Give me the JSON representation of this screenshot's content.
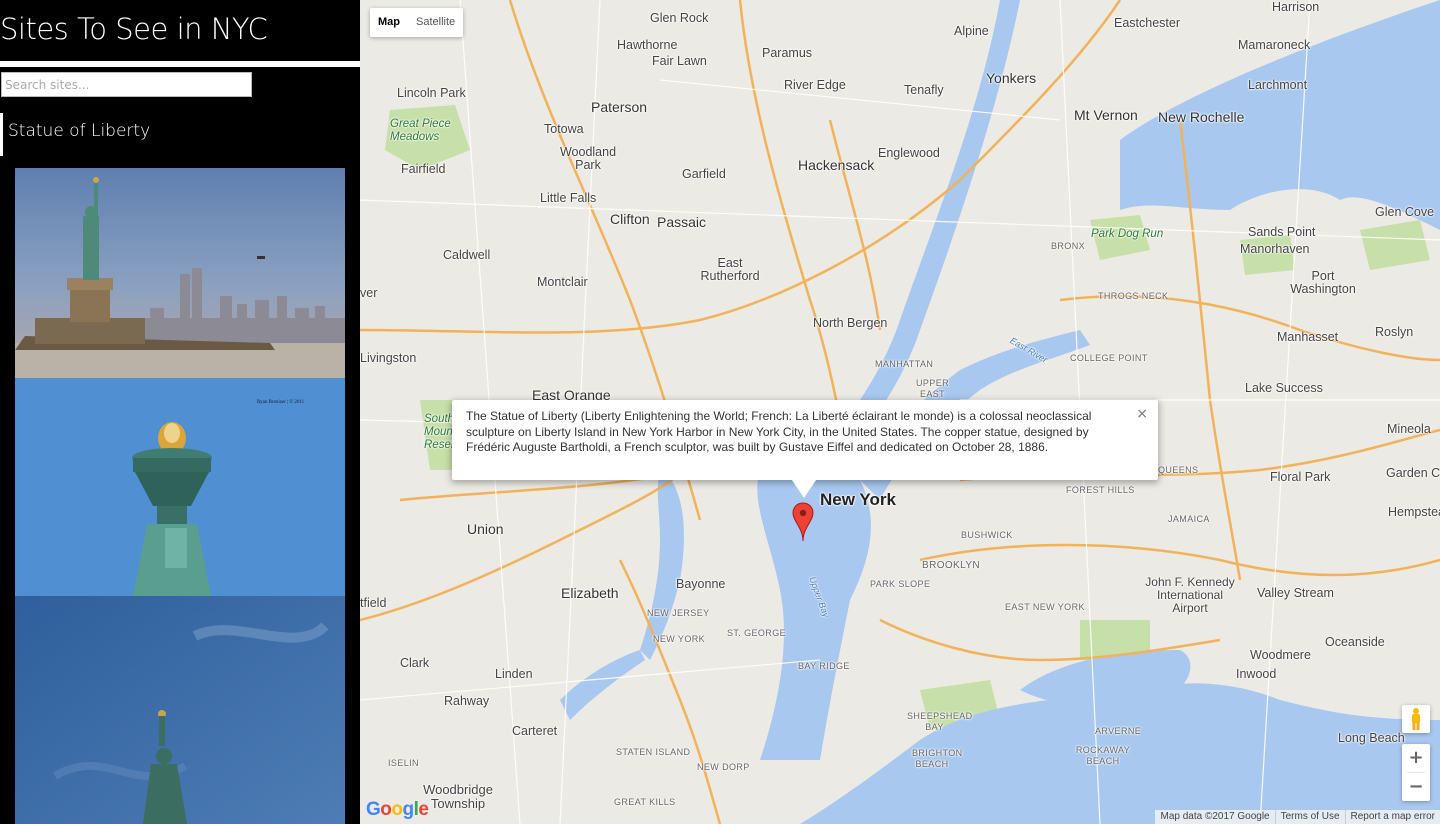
{
  "sidebar": {
    "title": "Sites To See in NYC",
    "search_placeholder": "Search sites...",
    "items": [
      {
        "label": "Statue of Liberty"
      }
    ],
    "photos": [
      {
        "credit": "Ryan Brenizer | © 2011"
      }
    ]
  },
  "map": {
    "type_control": {
      "map_label": "Map",
      "satellite_label": "Satellite",
      "selected": "Map"
    },
    "infowindow": {
      "text": "The Statue of Liberty (Liberty Enlightening the World; French: La Liberté éclairant le monde) is a colossal neoclassical sculpture on Liberty Island in New York Harbor in New York City, in the United States. The copper statue, designed by Frédéric Auguste Bartholdi, a French sculptor, was built by Gustave Eiffel and dedicated on October 28, 1886.",
      "close_symbol": "×"
    },
    "labels": {
      "glen_rock": "Glen Rock",
      "hawthorne": "Hawthorne",
      "paramus": "Paramus",
      "fair_lawn": "Fair Lawn",
      "river_edge": "River Edge",
      "alpine": "Alpine",
      "eastchester": "Eastchester",
      "harrison": "Harrison",
      "mamaroneck": "Mamaroneck",
      "larchmont": "Larchmont",
      "yonkers": "Yonkers",
      "lincoln_park": "Lincoln Park",
      "paterson": "Paterson",
      "tenafly": "Tenafly",
      "totowa": "Totowa",
      "great_piece_meadows": "Great Piece Meadows",
      "woodland_park": "Woodland Park",
      "hackensack": "Hackensack",
      "englewood": "Englewood",
      "mt_vernon": "Mt Vernon",
      "new_rochelle": "New Rochelle",
      "fairfield": "Fairfield",
      "garfield": "Garfield",
      "little_falls": "Little Falls",
      "clifton": "Clifton",
      "passaic": "Passaic",
      "glen_cove": "Glen Cove",
      "sands_point": "Sands Point",
      "manorhaven": "Manorhaven",
      "park_dog_run": "Park Dog Run",
      "bronx": "BRONX",
      "caldwell": "Caldwell",
      "east_rutherford": "East Rutherford",
      "port_washington": "Port Washington",
      "montclair": "Montclair",
      "throgs_neck": "THROGS NECK",
      "north_bergen": "North Bergen",
      "manhasset": "Manhasset",
      "roslyn": "Roslyn",
      "livingston": "Livingston",
      "manhattan": "MANHATTAN",
      "upper_east_side": "UPPER EAST SIDE",
      "college_point": "COLLEGE POINT",
      "east_river": "East River",
      "east_orange": "East Orange",
      "lake_success": "Lake Success",
      "mineola": "Mineola",
      "queens": "QUEENS",
      "new_york": "New York",
      "forest_hills": "FOREST HILLS",
      "floral_park": "Floral Park",
      "garden_city": "Garden City",
      "jamaica": "JAMAICA",
      "hempstead": "Hempstead",
      "union": "Union",
      "bushwick": "BUSHWICK",
      "brooklyn": "BROOKLYN",
      "elizabeth": "Elizabeth",
      "bayonne": "Bayonne",
      "valley_stream": "Valley Stream",
      "park_slope": "PARK SLOPE",
      "jfk": "John F. Kennedy International Airport",
      "new_jersey": "NEW JERSEY",
      "new_york_st": "NEW YORK",
      "st_george": "ST. GEORGE",
      "east_new_york": "EAST NEW YORK",
      "oceanside": "Oceanside",
      "woodmere": "Woodmere",
      "clark": "Clark",
      "bay_ridge": "BAY RIDGE",
      "linden": "Linden",
      "inwood": "Inwood",
      "rahway": "Rahway",
      "sheepshead_bay": "SHEEPSHEAD BAY",
      "arverne": "ARVERNE",
      "long_beach": "Long Beach",
      "carteret": "Carteret",
      "staten_island": "STATEN ISLAND",
      "new_dorp": "NEW DORP",
      "rockaway_beach": "ROCKAWAY BEACH",
      "brighton_beach": "BRIGHTON BEACH",
      "iselin": "ISELIN",
      "woodbridge_township": "Woodbridge Township",
      "great_kills": "GREAT KILLS",
      "upper_bay": "Upper Bay",
      "south_mountain_reservation": "South Mountain Reservation",
      "tfield": "tfield",
      "ver": "ver"
    },
    "zoom_in": "+",
    "zoom_out": "−",
    "attribution": {
      "data": "Map data ©2017 Google",
      "terms": "Terms of Use",
      "report": "Report a map error"
    },
    "logo": {
      "letters": [
        "G",
        "o",
        "o",
        "g",
        "l",
        "e"
      ],
      "colors": [
        "#4285f4",
        "#ea4335",
        "#fbbc05",
        "#4285f4",
        "#34a853",
        "#ea4335"
      ]
    }
  }
}
